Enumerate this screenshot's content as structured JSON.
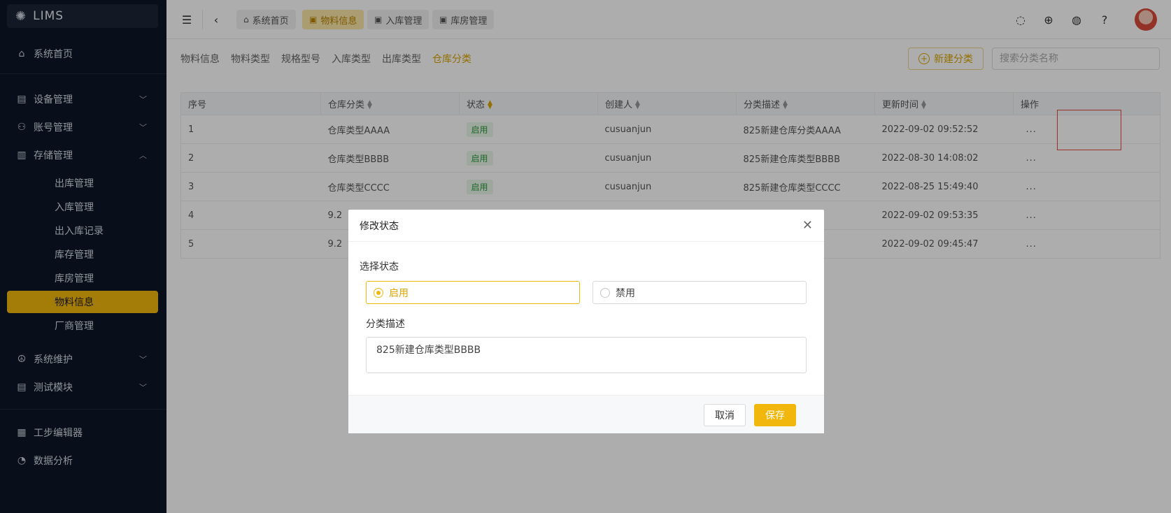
{
  "app": {
    "title": "LIMS"
  },
  "sidebar": {
    "items": [
      {
        "label": "系统首页",
        "icon": "home-icon"
      },
      {
        "label": "设备管理",
        "icon": "device-icon",
        "expandable": true
      },
      {
        "label": "账号管理",
        "icon": "users-icon",
        "expandable": true
      },
      {
        "label": "存储管理",
        "icon": "storage-icon",
        "expandable": true,
        "expanded": true
      },
      {
        "label": "系统维护",
        "icon": "maintenance-icon",
        "expandable": true
      },
      {
        "label": "测试模块",
        "icon": "test-icon",
        "expandable": true
      },
      {
        "label": "工步编辑器",
        "icon": "grid-icon"
      },
      {
        "label": "数据分析",
        "icon": "chart-icon"
      }
    ],
    "storage_children": [
      "出库管理",
      "入库管理",
      "出入库记录",
      "库存管理",
      "库房管理",
      "物料信息",
      "厂商管理"
    ],
    "active_child": "物料信息"
  },
  "tabs": [
    {
      "label": "系统首页",
      "active": false
    },
    {
      "label": "物料信息",
      "active": true
    },
    {
      "label": "入库管理",
      "active": false
    },
    {
      "label": "库房管理",
      "active": false
    }
  ],
  "subtabs": [
    "物料信息",
    "物料类型",
    "规格型号",
    "入库类型",
    "出库类型",
    "仓库分类"
  ],
  "active_subtab": "仓库分类",
  "toolbar": {
    "new_button": "新建分类",
    "search_placeholder": "搜索分类名称"
  },
  "table": {
    "headers": [
      "序号",
      "仓库分类",
      "状态",
      "创建人",
      "分类描述",
      "更新时间",
      "操作"
    ],
    "rows": [
      {
        "no": "1",
        "category": "仓库类型AAAA",
        "status": "启用",
        "creator": "cusuanjun",
        "desc": "825新建仓库分类AAAA",
        "updated": "2022-09-02 09:52:52",
        "op": "..."
      },
      {
        "no": "2",
        "category": "仓库类型BBBB",
        "status": "启用",
        "creator": "cusuanjun",
        "desc": "825新建仓库类型BBBB",
        "updated": "2022-08-30 14:08:02",
        "op": "..."
      },
      {
        "no": "3",
        "category": "仓库类型CCCC",
        "status": "启用",
        "creator": "cusuanjun",
        "desc": "825新建仓库类型CCCC",
        "updated": "2022-08-25 15:49:40",
        "op": "..."
      },
      {
        "no": "4",
        "category": "9.2",
        "status": "",
        "creator": "",
        "desc": "",
        "updated": "2022-09-02 09:53:35",
        "op": "..."
      },
      {
        "no": "5",
        "category": "9.2",
        "status": "",
        "creator": "",
        "desc": "",
        "updated": "2022-09-02 09:45:47",
        "op": "..."
      }
    ]
  },
  "modal": {
    "title": "修改状态",
    "status_label": "选择状态",
    "options": [
      "启用",
      "禁用"
    ],
    "selected": "启用",
    "desc_label": "分类描述",
    "desc_value": "825新建仓库类型BBBB",
    "cancel": "取消",
    "save": "保存"
  },
  "colors": {
    "accent": "#f2b70c",
    "sidebar_bg": "#0d1727",
    "highlight_box": "#e2483d"
  }
}
